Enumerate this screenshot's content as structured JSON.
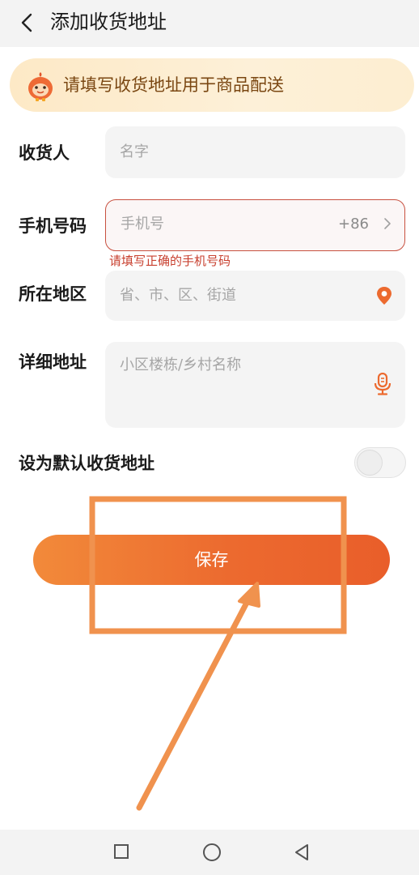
{
  "header": {
    "title": "添加收货地址"
  },
  "banner": {
    "text": "请填写收货地址用于商品配送"
  },
  "form": {
    "recipient": {
      "label": "收货人",
      "placeholder": "名字"
    },
    "phone": {
      "label": "手机号码",
      "placeholder": "手机号",
      "prefix": "+86",
      "error": "请填写正确的手机号码"
    },
    "region": {
      "label": "所在地区",
      "placeholder": "省、市、区、街道"
    },
    "address": {
      "label": "详细地址",
      "placeholder": "小区楼栋/乡村名称"
    },
    "default_toggle": {
      "label": "设为默认收货地址",
      "on": false
    }
  },
  "save_button": {
    "label": "保存"
  },
  "colors": {
    "accent": "#ec6a2f",
    "error": "#c8402f",
    "annotation": "#f0924e"
  },
  "icons": [
    "back-arrow-icon",
    "mascot-icon",
    "chevron-right-icon",
    "location-pin-icon",
    "microphone-icon",
    "nav-square-icon",
    "nav-circle-icon",
    "nav-back-icon"
  ]
}
